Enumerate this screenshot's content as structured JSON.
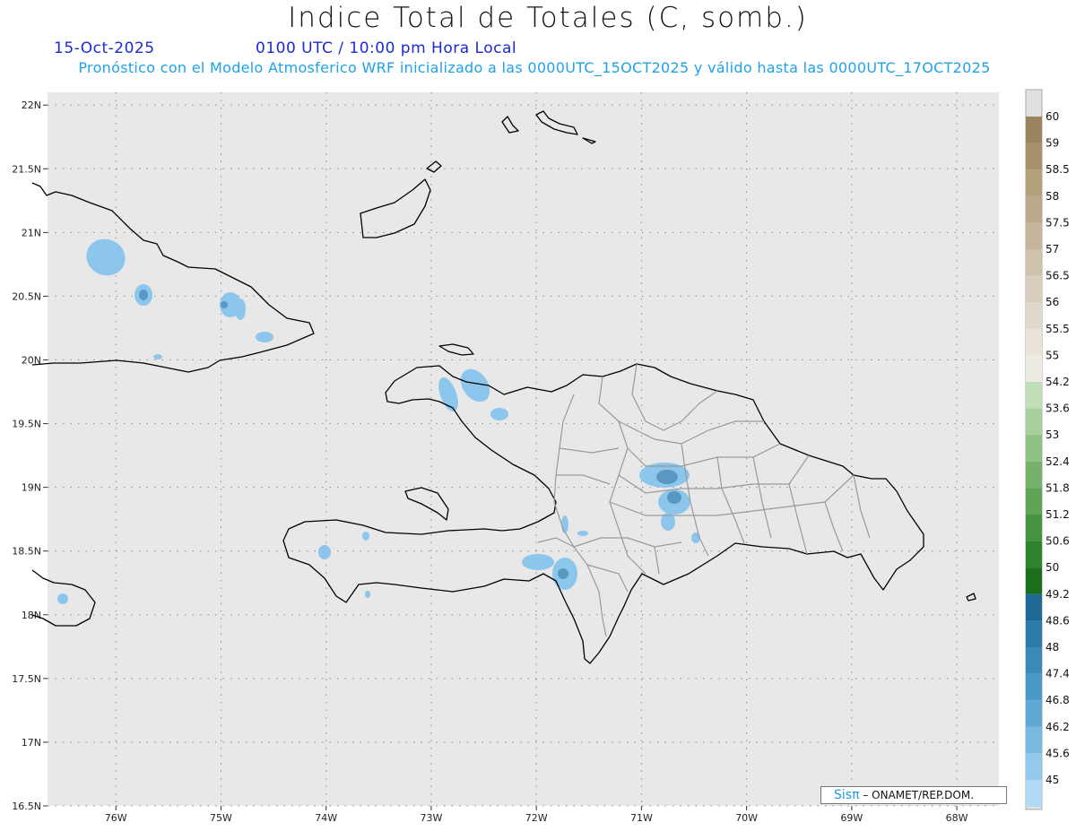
{
  "header": {
    "title": "Indice Total de Totales (C, somb.)",
    "date": "15-Oct-2025",
    "time": "0100 UTC / 10:00 pm Hora Local",
    "subtitle": "Pronóstico con el Modelo Atmosferico WRF inicializado a las 0000UTC_15OCT2025 y válido hasta las  0000UTC_17OCT2025"
  },
  "map": {
    "lat_labels": [
      "22N",
      "21.5N",
      "21N",
      "20.5N",
      "20N",
      "19.5N",
      "19N",
      "18.5N",
      "18N",
      "17.5N",
      "17N",
      "16.5N"
    ],
    "lat_values": [
      22,
      21.5,
      21,
      20.5,
      20,
      19.5,
      19,
      18.5,
      18,
      17.5,
      17,
      16.5
    ],
    "lon_labels": [
      "76W",
      "75W",
      "74W",
      "73W",
      "72W",
      "71W",
      "70W",
      "69W",
      "68W"
    ],
    "lon_values": [
      -76,
      -75,
      -74,
      -73,
      -72,
      -71,
      -70,
      -69,
      -68
    ],
    "lat_range": [
      16.5,
      22.1
    ],
    "lon_range": [
      -76.65,
      -67.6
    ],
    "grid": true,
    "background_color": "#e8e8e8",
    "coast_color": "#000000",
    "province_color": "#9a9a9a"
  },
  "colorbar": {
    "labels": [
      "60",
      "59",
      "58.5",
      "58",
      "57.5",
      "57",
      "56.5",
      "56",
      "55.5",
      "55",
      "54.2",
      "53.6",
      "53",
      "52.4",
      "51.8",
      "51.2",
      "50.6",
      "50",
      "49.2",
      "48.6",
      "48",
      "47.4",
      "46.8",
      "46.2",
      "45.6",
      "45"
    ],
    "colors": [
      "#9b8460",
      "#a8926c",
      "#b29f7c",
      "#bca98a",
      "#c5b59a",
      "#cfc2aa",
      "#d8cebb",
      "#e0d8ca",
      "#e9e4da",
      "#eeebe2",
      "#c0dfb6",
      "#a8d09c",
      "#8fc183",
      "#77b26c",
      "#5fa356",
      "#479440",
      "#2e832d",
      "#1c6e1c",
      "#1f6a95",
      "#2c7aa7",
      "#3a8ab7",
      "#4a99c6",
      "#5fa9d4",
      "#79b9e0",
      "#93c9ea",
      "#b0d9f3"
    ]
  },
  "credit": {
    "logo": "Sisπ",
    "text": "– ONAMET/REP.DOM."
  }
}
